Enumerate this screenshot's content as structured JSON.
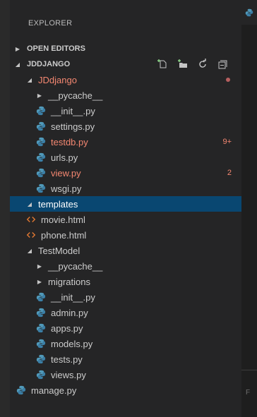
{
  "explorer_title": "EXPLORER",
  "sections": {
    "open_editors": "OPEN EDITORS",
    "project": "JDDJANGO"
  },
  "tree": [
    {
      "indent": 1,
      "kind": "folder-open",
      "label": "JDdjango",
      "status": "dot"
    },
    {
      "indent": 2,
      "kind": "folder-closed",
      "label": "__pycache__"
    },
    {
      "indent": 2,
      "kind": "python",
      "label": "__init__.py"
    },
    {
      "indent": 2,
      "kind": "python",
      "label": "settings.py"
    },
    {
      "indent": 2,
      "kind": "python",
      "label": "testdb.py",
      "status": "error",
      "badge": "9+"
    },
    {
      "indent": 2,
      "kind": "python",
      "label": "urls.py"
    },
    {
      "indent": 2,
      "kind": "python",
      "label": "view.py",
      "status": "error",
      "badge": "2"
    },
    {
      "indent": 2,
      "kind": "python",
      "label": "wsgi.py"
    },
    {
      "indent": 1,
      "kind": "folder-open",
      "label": "templates",
      "selected": true
    },
    {
      "indent": 1,
      "kind": "html",
      "label": "movie.html"
    },
    {
      "indent": 1,
      "kind": "html",
      "label": "phone.html"
    },
    {
      "indent": 1,
      "kind": "folder-open",
      "label": "TestModel"
    },
    {
      "indent": 2,
      "kind": "folder-closed",
      "label": "__pycache__"
    },
    {
      "indent": 2,
      "kind": "folder-closed",
      "label": "migrations"
    },
    {
      "indent": 2,
      "kind": "python",
      "label": "__init__.py"
    },
    {
      "indent": 2,
      "kind": "python",
      "label": "admin.py"
    },
    {
      "indent": 2,
      "kind": "python",
      "label": "apps.py"
    },
    {
      "indent": 2,
      "kind": "python",
      "label": "models.py"
    },
    {
      "indent": 2,
      "kind": "python",
      "label": "tests.py"
    },
    {
      "indent": 2,
      "kind": "python",
      "label": "views.py"
    },
    {
      "indent": 0,
      "kind": "python",
      "label": "manage.py"
    }
  ],
  "panel_label": "F",
  "colors": {
    "python_icon": "#519aba",
    "html_icon": "#e37933",
    "error_text": "#f48771",
    "selection": "#094771",
    "folder_dot": "#b65f5f"
  }
}
